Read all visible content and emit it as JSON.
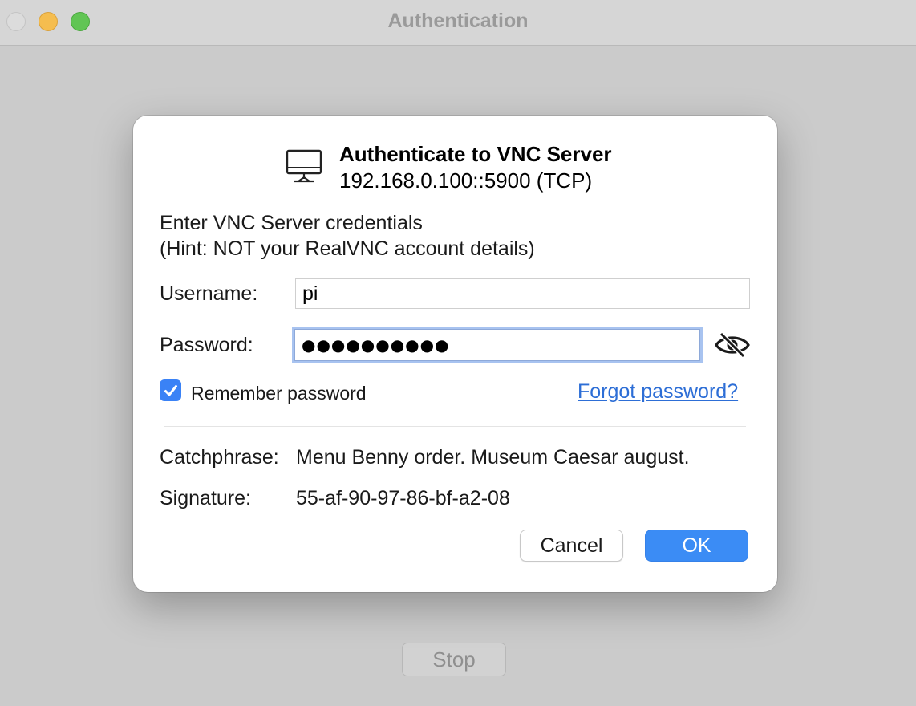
{
  "window": {
    "title": "Authentication",
    "stop_label": "Stop"
  },
  "dialog": {
    "icon": "monitor-icon",
    "heading": "Authenticate to VNC Server",
    "server_address": "192.168.0.100::5900 (TCP)",
    "prompt_line1": "Enter VNC Server credentials",
    "prompt_line2": "(Hint: NOT your RealVNC account details)",
    "username_label": "Username:",
    "username_value": "pi",
    "password_label": "Password:",
    "password_value": "●●●●●●●●●●",
    "show_password_icon": "eye-slash-icon",
    "remember_label": "Remember password",
    "remember_checked": true,
    "forgot_link": "Forgot password?",
    "catchphrase_label": "Catchphrase:",
    "catchphrase_value": "Menu Benny order. Museum Caesar august.",
    "signature_label": "Signature:",
    "signature_value": "55-af-90-97-86-bf-a2-08",
    "cancel_label": "Cancel",
    "ok_label": "OK"
  },
  "colors": {
    "accent": "#3b8cf5",
    "link": "#2d6ed6",
    "close": "#dcdcdc",
    "minimize": "#f5bd4f",
    "maximize": "#61c554"
  }
}
